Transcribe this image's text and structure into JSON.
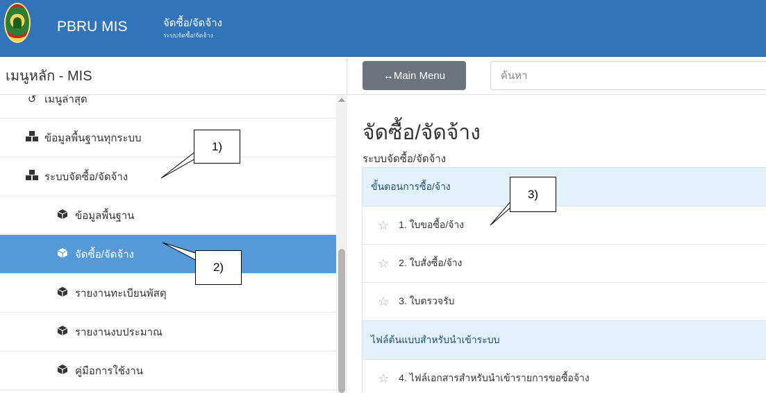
{
  "header": {
    "app_title": "PBRU MIS",
    "module_title": "จัดซื้อ/จัดจ้าง",
    "module_subtitle": "ระบบจัดซื้อ/จัดจ้าง",
    "bar_color": "#3174b9"
  },
  "sidebar": {
    "heading": "เมนูหลัก - MIS",
    "items": [
      {
        "label": "เมนูล่าสุด",
        "icon": "history-icon",
        "level": 1,
        "active": false
      },
      {
        "label": "ข้อมูลพื้นฐานทุกระบบ",
        "icon": "cubes-icon",
        "level": 1,
        "active": false
      },
      {
        "label": "ระบบจัดซื้อ/จัดจ้าง",
        "icon": "cubes-icon",
        "level": 1,
        "active": false
      },
      {
        "label": "ข้อมูลพื้นฐาน",
        "icon": "cube-icon",
        "level": 2,
        "active": false
      },
      {
        "label": "จัดซื้อ/จัดจ้าง",
        "icon": "cube-icon",
        "level": 2,
        "active": true
      },
      {
        "label": "รายงานทะเบียนพัสดุ",
        "icon": "cube-icon",
        "level": 2,
        "active": false
      },
      {
        "label": "รายงานงบประมาณ",
        "icon": "cube-icon",
        "level": 2,
        "active": false
      },
      {
        "label": "คู่มือการใช้งาน",
        "icon": "cube-icon",
        "level": 2,
        "active": false
      }
    ],
    "active_color": "#5499d8"
  },
  "toolbar": {
    "main_menu_label": "↔Main Menu",
    "search_placeholder": "ค้นหา"
  },
  "content": {
    "title": "จัดซื้อ/จัดจ้าง",
    "subtitle": "ระบบจัดซื้อ/จัดจ้าง",
    "sections": [
      {
        "header": "ขั้นตอนการซื้อ/จ้าง",
        "rows": [
          "1. ใบขอซื้อ/จ้าง",
          "2. ใบสั่งซื้อ/จ้าง",
          "3. ใบตรวจรับ"
        ]
      },
      {
        "header": "ไฟล์ต้นแบบสำหรับนำเข้าระบบ",
        "rows": [
          "4. ไฟล์เอกสารสำหรับนำเข้ารายการขอซื้อจ้าง"
        ]
      }
    ],
    "section_color": "#e3f1fb"
  },
  "annotations": {
    "callout_1": "1)",
    "callout_2": "2)",
    "callout_3": "3)"
  }
}
